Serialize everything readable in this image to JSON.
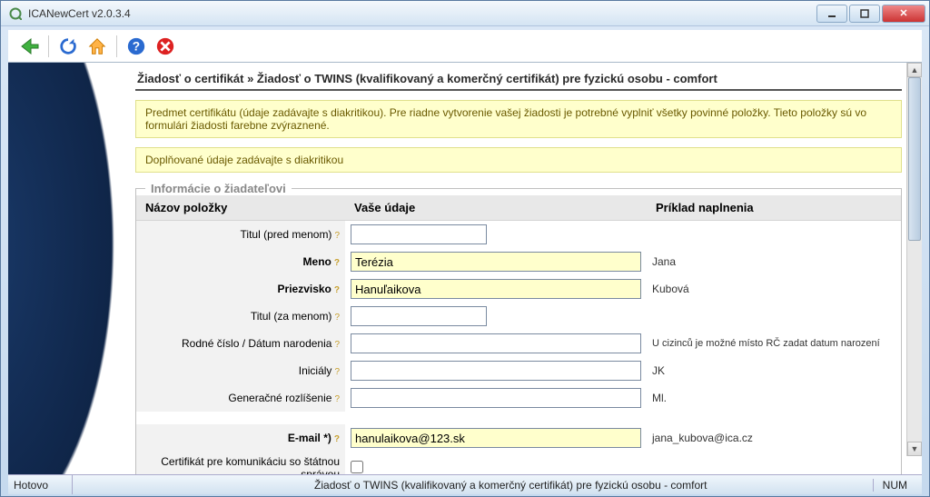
{
  "window": {
    "title": "ICANewCert v2.0.3.4"
  },
  "toolbar": {
    "back": "back",
    "refresh": "refresh",
    "home": "home",
    "help": "help",
    "stop": "stop"
  },
  "breadcrumb": "Žiadosť o certifikát » Žiadosť o TWINS (kvalifikovaný a komerčný certifikát) pre fyzickú osobu - comfort",
  "notice1": "Predmet certifikátu (údaje zadávajte s diakritikou). Pre riadne vytvorenie vašej žiadosti je potrebné vyplniť všetky povinné položky. Tieto položky sú vo formulári žiadosti farebne zvýraznené.",
  "notice2": "Doplňované údaje zadávajte s diakritikou",
  "fieldset_legend": "Informácie o žiadateľovi",
  "headers": {
    "col_label": "Názov položky",
    "col_value": "Vaše údaje",
    "col_example": "Príklad naplnenia"
  },
  "rows": {
    "title_before": {
      "label": "Titul (pred menom)",
      "value": "",
      "example": ""
    },
    "first_name": {
      "label": "Meno",
      "value": "Terézia",
      "example": "Jana"
    },
    "last_name": {
      "label": "Priezvisko",
      "value": "Hanuľaikova",
      "example": "Kubová"
    },
    "title_after": {
      "label": "Titul (za menom)",
      "value": "",
      "example": ""
    },
    "birth_no": {
      "label": "Rodné číslo / Dátum narodenia",
      "value": "",
      "example": "U cizinců je možné místo RČ zadat datum narození"
    },
    "initials": {
      "label": "Iniciály",
      "value": "",
      "example": "JK"
    },
    "generation": {
      "label": "Generačné rozlíšenie",
      "value": "",
      "example": "Ml."
    },
    "email": {
      "label": "E-mail *)",
      "value": "hanulaikova@123.sk",
      "example": "jana_kubova@ica.cz"
    },
    "cert_gov": {
      "label": "Certifikát pre komunikáciu so štátnou správou",
      "checked": false
    }
  },
  "statusbar": {
    "left": "Hotovo",
    "mid": "Žiadosť o TWINS (kvalifikovaný a komerčný certifikát) pre fyzickú osobu - comfort",
    "right": "NUM"
  }
}
